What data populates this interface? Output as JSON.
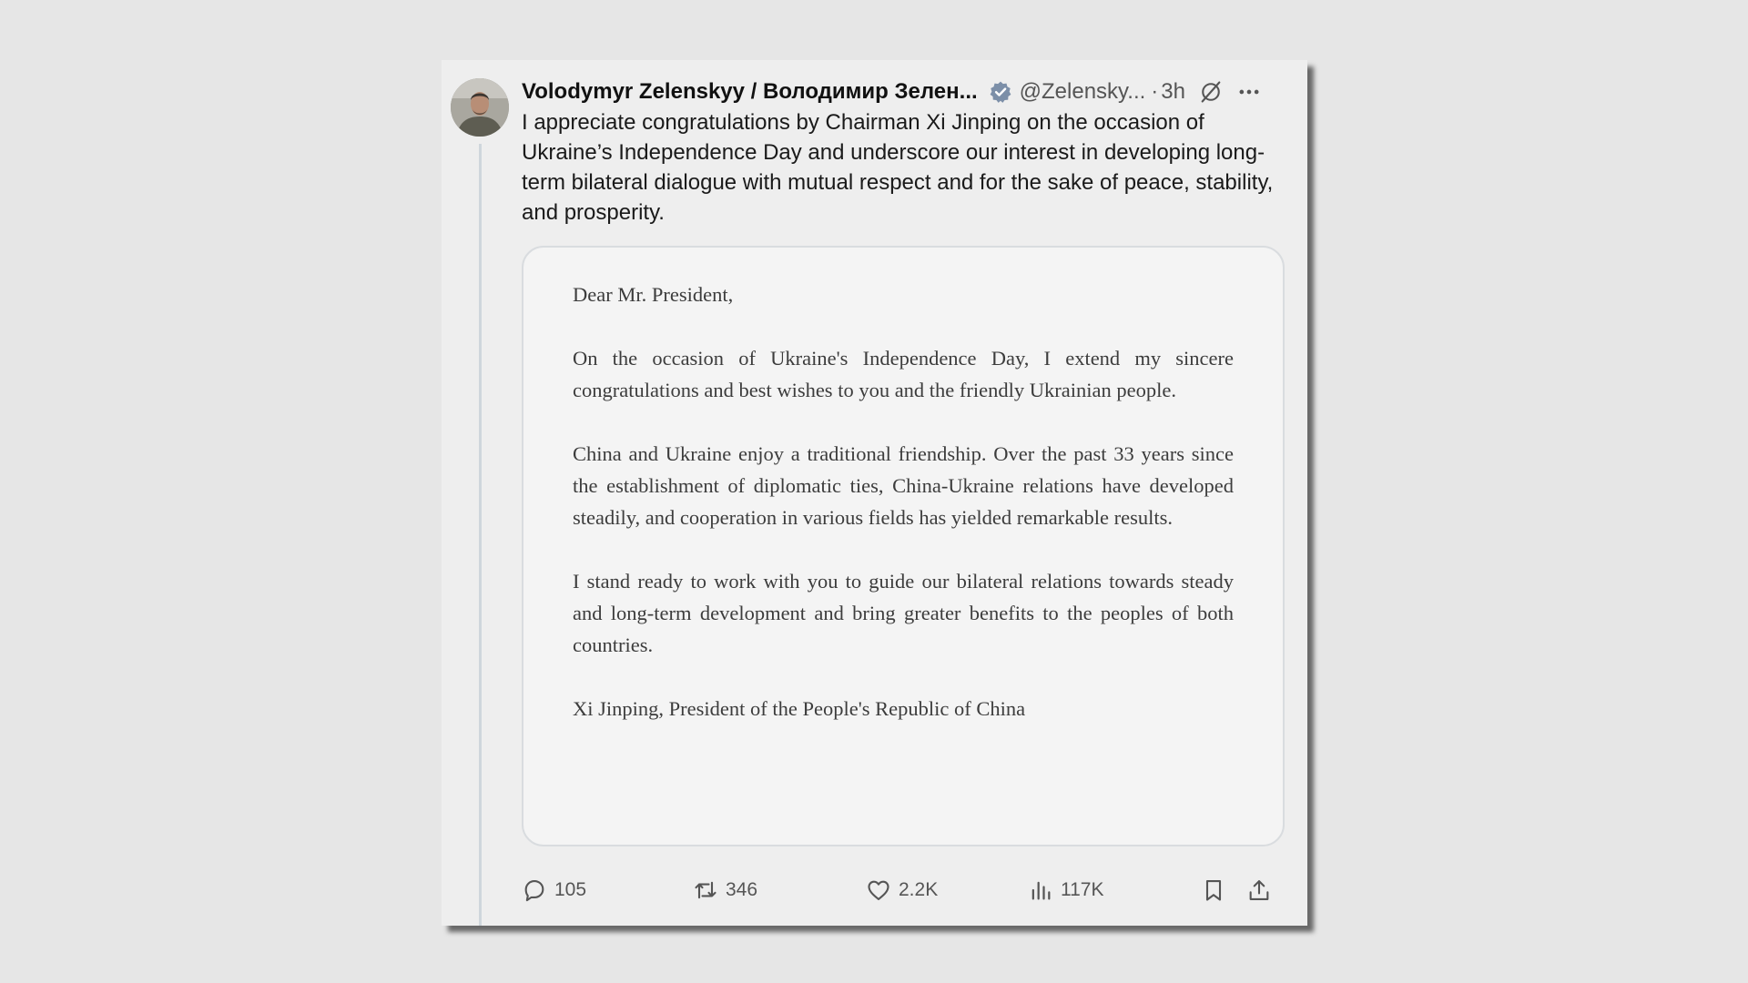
{
  "tweet": {
    "display_name": "Volodymyr Zelenskyy / Володимир Зелен...",
    "handle": "@Zelensky...",
    "separator": "·",
    "time": "3h",
    "text": "I appreciate congratulations by Chairman Xi Jinping on the occasion of Ukraine’s Independence Day and underscore our interest in developing long-term bilateral dialogue with mutual respect and for the sake of peace, stability, and prosperity."
  },
  "letter": {
    "salutation": "Dear Mr. President,",
    "paragraphs": [
      "On the occasion of Ukraine's Independence Day, I extend my sincere congratulations and best wishes to you and the friendly Ukrainian people.",
      "China and Ukraine enjoy a traditional friendship. Over the past 33 years since the establishment of diplomatic ties, China-Ukraine relations have developed steadily, and cooperation in various fields has yielded remarkable results.",
      "I stand ready to work with you to guide our bilateral relations towards steady and long-term development and bring greater benefits to the peoples of both countries."
    ],
    "signature": "Xi Jinping, President of the People's Republic of China"
  },
  "actions": {
    "replies": "105",
    "reposts": "346",
    "likes": "2.2K",
    "views": "117K"
  },
  "icons": {
    "verified": "verified-badge-icon",
    "grok": "grok-icon",
    "more": "more-icon",
    "reply": "reply-icon",
    "repost": "repost-icon",
    "like": "heart-icon",
    "views": "views-chart-icon",
    "bookmark": "bookmark-icon",
    "share": "share-icon"
  },
  "colors": {
    "verified": "#7c8fa8",
    "icon_gray": "#555555",
    "background": "#e6e6e6"
  }
}
